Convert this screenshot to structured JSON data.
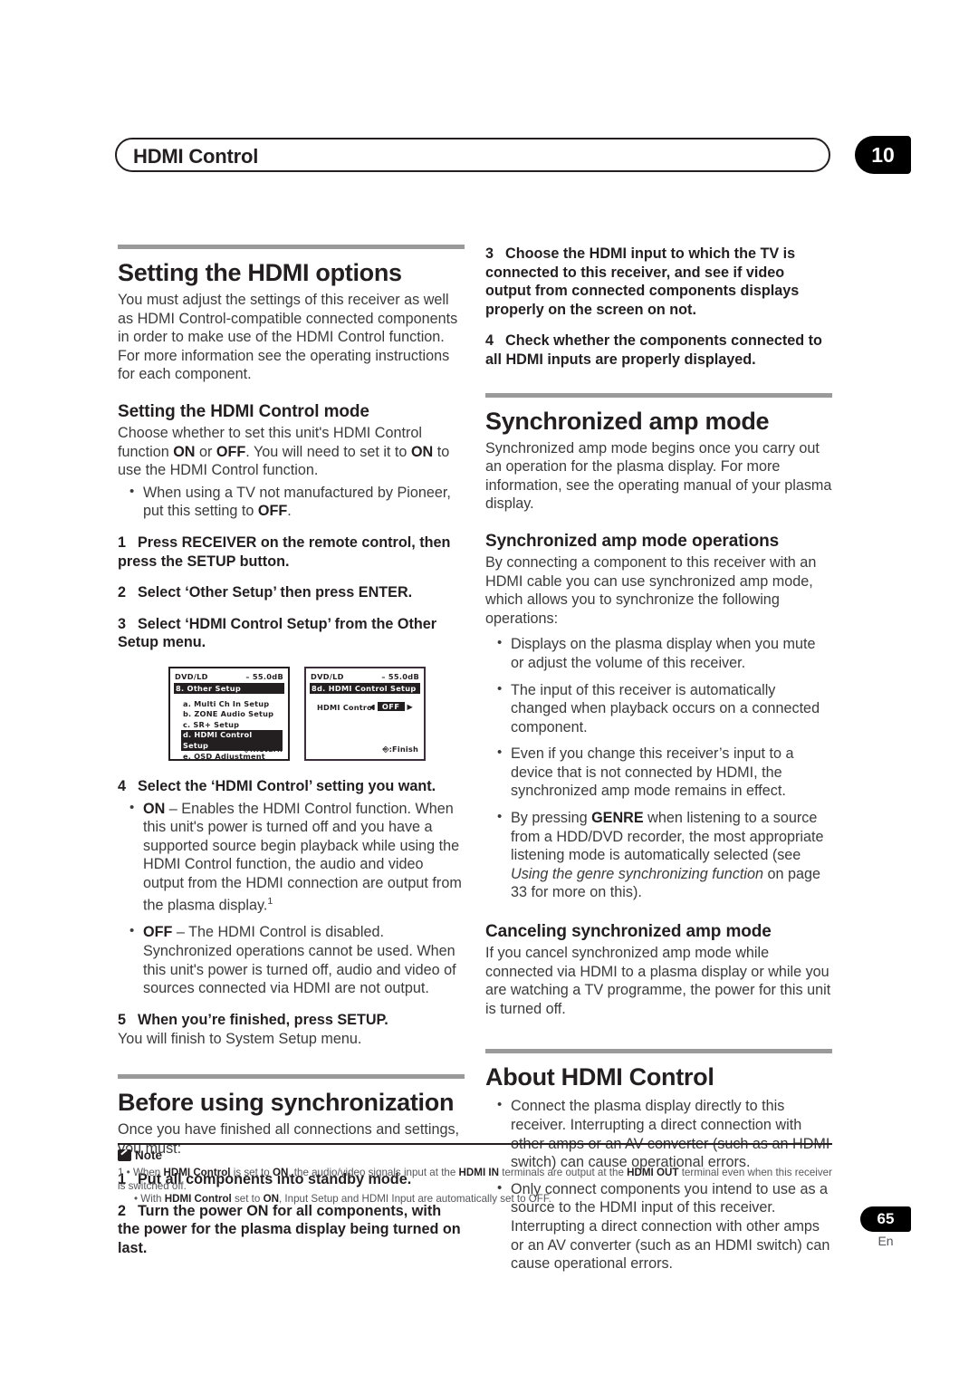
{
  "header": {
    "title": "HDMI Control",
    "chapter": "10"
  },
  "left_column": {
    "section1": {
      "heading": "Setting the HDMI options",
      "intro": "You must adjust the settings of this receiver as well as HDMI Control-compatible connected components in order to make use of the HDMI Control function. For more information see the operating instructions for each component.",
      "sub_heading": "Setting the HDMI Control mode",
      "sub_intro_a": "Choose whether to set this unit's HDMI Control function ",
      "sub_intro_on": "ON",
      "sub_intro_b": " or ",
      "sub_intro_off": "OFF",
      "sub_intro_c": ". You will need to set it to ",
      "sub_intro_on2": "ON",
      "sub_intro_d": " to use the HDMI Control function.",
      "bullet1_a": "When using a TV not manufactured by Pioneer, put this setting to ",
      "bullet1_off": "OFF",
      "bullet1_b": ".",
      "step1_num": "1",
      "step1_text": "Press RECEIVER on the remote control, then press the SETUP button.",
      "step2_num": "2",
      "step2_text": "Select ‘Other Setup’ then press ENTER.",
      "step3_num": "3",
      "step3_text": "Select ‘HDMI Control Setup’ from the Other Setup menu.",
      "step4_num": "4",
      "step4_text": "Select the ‘HDMI Control’ setting you want.",
      "bullet_on_label": "ON",
      "bullet_on_text": " – Enables the HDMI Control function. When this unit's power is turned off and you have a supported source begin playback while using the HDMI Control function, the audio and video output from the HDMI connection are output from the plasma display.",
      "bullet_on_footnote": "1",
      "bullet_off_label": "OFF",
      "bullet_off_text": " – The HDMI Control is disabled. Synchronized operations cannot be used. When this unit's power is turned off, audio and video of sources connected via HDMI are not output.",
      "step5_num": "5",
      "step5_text": "When you’re finished, press SETUP.",
      "step5_follow": "You will finish to System Setup menu."
    },
    "osd_screens": [
      {
        "source": "DVD/LD",
        "volume": "– 55.0dB",
        "title": "8. Other Setup",
        "items": [
          {
            "label": "a. Multi Ch In Setup",
            "selected": false
          },
          {
            "label": "b. ZONE Audio Setup",
            "selected": false
          },
          {
            "label": "c. SR+ Setup",
            "selected": false
          },
          {
            "label": "d. HDMI Control Setup",
            "selected": true
          },
          {
            "label": "e. OSD Adjustment",
            "selected": false
          }
        ],
        "bottom_label": ":Return"
      },
      {
        "source": "DVD/LD",
        "volume": "– 55.0dB",
        "title": "8d. HDMI Control Setup",
        "row_label": "HDMI Control",
        "row_value": "OFF",
        "arrow_left": "◀",
        "arrow_right": "▶",
        "bottom_label": ":Finish"
      }
    ],
    "section2": {
      "heading": "Before using synchronization",
      "intro": "Once you have finished all connections and settings, you must:",
      "step1_num": "1",
      "step1_text": "Put all components into standby mode.",
      "step2_num": "2",
      "step2_text": "Turn the power ON for all components, with the power for the plasma display being turned on last."
    }
  },
  "right_column": {
    "continued_steps": {
      "step3_num": "3",
      "step3_text": "Choose the HDMI input to which the TV is connected to this receiver, and see if video output from connected components displays properly on the screen on not.",
      "step4_num": "4",
      "step4_text": "Check whether the components connected to all HDMI inputs are properly displayed."
    },
    "section3": {
      "heading": "Synchronized amp mode",
      "intro": "Synchronized amp mode begins once you carry out an operation for the plasma display. For more information, see the operating manual of your plasma display.",
      "sub_heading": "Synchronized amp mode operations",
      "sub_intro": "By connecting a component to this receiver with an HDMI cable you can use synchronized amp mode, which allows you to synchronize the following operations:",
      "bullet1": "Displays on the plasma display when you mute or adjust the volume of this receiver.",
      "bullet2": "The input of this receiver is automatically changed when playback occurs on a connected component.",
      "bullet3": "Even if you change this receiver’s input to a device that is not connected by HDMI, the synchronized amp mode remains in effect.",
      "bullet4_a": "By pressing ",
      "bullet4_genre": "GENRE",
      "bullet4_b": " when listening to a source from a HDD/DVD recorder, the most appropriate listening mode is automatically selected (see ",
      "bullet4_italic": "Using the genre synchronizing function",
      "bullet4_c": " on page 33 for more on this).",
      "cancel_heading": "Canceling synchronized amp mode",
      "cancel_text": "If you cancel synchronized amp mode while connected via HDMI to a plasma display or while you are watching a TV programme, the power for this unit is turned off."
    },
    "section4": {
      "heading": "About HDMI Control",
      "bullet1": "Connect the plasma display directly to this receiver. Interrupting a direct connection with other amps or an AV converter (such as an HDMI switch) can cause operational errors.",
      "bullet2": "Only connect components you intend to use as a source to the HDMI input of this receiver. Interrupting a direct connection with other amps or an AV converter (such as an HDMI switch) can cause operational errors."
    }
  },
  "note": {
    "label": "Note",
    "fn_num": "1",
    "line1_a": " • When ",
    "line1_b1": "HDMI Control",
    "line1_c": " is set to ",
    "line1_b2": "ON",
    "line1_d": ", the audio/video signals input at the ",
    "line1_b3": "HDMI IN",
    "line1_e": " terminals are output at the ",
    "line1_b4": "HDMI OUT",
    "line1_f": " terminal even when this receiver is switched off.",
    "line2_a": "• With ",
    "line2_b1": "HDMI Control",
    "line2_c": " set to ",
    "line2_b2": "ON",
    "line2_d": ", Input Setup and HDMI Input are automatically set to OFF."
  },
  "footer": {
    "page_number": "65",
    "language": "En"
  }
}
